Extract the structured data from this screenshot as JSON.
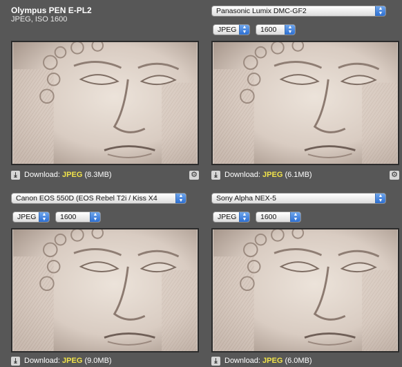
{
  "cells": [
    {
      "camera_title": "Olympus PEN E-PL2",
      "subtitle": "JPEG, ISO 1600",
      "download_label": "Download:",
      "format": "JPEG",
      "size": "(8.3MB)"
    },
    {
      "camera_select": "Panasonic Lumix DMC-GF2",
      "format_select": "JPEG",
      "iso_select": "1600",
      "download_label": "Download:",
      "format": "JPEG",
      "size": "(6.1MB)"
    },
    {
      "camera_select": "Canon EOS 550D (EOS Rebel T2i / Kiss X4",
      "format_select": "JPEG",
      "iso_select": "1600",
      "download_label": "Download:",
      "format": "JPEG",
      "size": "(9.0MB)"
    },
    {
      "camera_select": "Sony Alpha NEX-5",
      "format_select": "JPEG",
      "iso_select": "1600",
      "download_label": "Download:",
      "format": "JPEG",
      "size": "(6.0MB)"
    }
  ],
  "icons": {
    "download": "download-icon",
    "gear": "gear-icon",
    "select_arrow": "chevron-updown-icon"
  },
  "colors": {
    "background": "#575757",
    "format_highlight": "#f2e44a",
    "select_arrow": "#2d6fd1"
  }
}
